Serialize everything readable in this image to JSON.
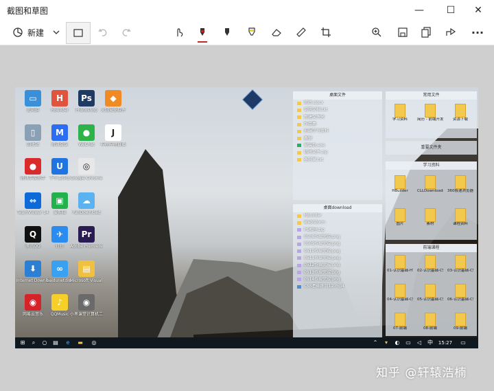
{
  "app": {
    "title": "截图和草图"
  },
  "window_controls": {
    "minimize": "—",
    "maximize": "☐",
    "close": "✕"
  },
  "toolbar": {
    "new_label": "新建",
    "icons": [
      "new-snip-icon",
      "chevron-down-icon",
      "open-file-icon",
      "undo-icon",
      "redo-icon",
      "touch-writing-icon",
      "ballpoint-pen-icon",
      "pencil-icon",
      "highlighter-icon",
      "eraser-icon",
      "ruler-icon",
      "crop-icon",
      "zoom-in-icon",
      "save-icon",
      "copy-icon",
      "share-icon",
      "more-icon"
    ],
    "more_label": "···",
    "accent_color": "#c62828"
  },
  "desktop": {
    "icons": [
      {
        "label": "此电脑",
        "color": "#3a8fd9",
        "glyph": "▭"
      },
      {
        "label": "HBuilder",
        "color": "#e0533c",
        "glyph": "H"
      },
      {
        "label": "Photoshop",
        "color": "#1f3a63",
        "glyph": "Ps"
      },
      {
        "label": "火绒安全软件",
        "color": "#f08a24",
        "glyph": "◆"
      },
      {
        "label": "回收站",
        "color": "#8aa0b4",
        "glyph": "▯"
      },
      {
        "label": "腾讯会议",
        "color": "#2b6ef2",
        "glyph": "M"
      },
      {
        "label": "WeChat",
        "color": "#2db34a",
        "glyph": "●"
      },
      {
        "label": "哔哩哔哩直播",
        "color": "#ffffff",
        "glyph": "J"
      },
      {
        "label": "腾讯手游助手",
        "color": "#d92b2b",
        "glyph": "●"
      },
      {
        "label": "千牛工作台",
        "color": "#1f74e0",
        "glyph": "U"
      },
      {
        "label": "Google Chrome",
        "color": "#e8e8e8",
        "glyph": "◎"
      },
      {
        "label": "",
        "color": "",
        "glyph": ""
      },
      {
        "label": "TeamViewer 14",
        "color": "#0e6ad8",
        "glyph": "⇔"
      },
      {
        "label": "爱剪辑",
        "color": "#22b14c",
        "glyph": "▣"
      },
      {
        "label": "PanDownload",
        "color": "#5ab3f0",
        "glyph": "☁"
      },
      {
        "label": "",
        "color": "",
        "glyph": ""
      },
      {
        "label": "腾讯QQ",
        "color": "#111111",
        "glyph": "Q"
      },
      {
        "label": "钉钉",
        "color": "#2a8cf0",
        "glyph": "✈"
      },
      {
        "label": "Adobe Premiere Pro",
        "color": "#2b1b53",
        "glyph": "Pr"
      },
      {
        "label": "",
        "color": "",
        "glyph": ""
      },
      {
        "label": "Internet Download Manager",
        "color": "#2d7fd3",
        "glyph": "⬇"
      },
      {
        "label": "baidunetdisk",
        "color": "#3aa0f0",
        "glyph": "∞"
      },
      {
        "label": "Microsoft Visual C++ 2...",
        "color": "#f0c040",
        "glyph": "▤"
      },
      {
        "label": "",
        "color": "",
        "glyph": ""
      },
      {
        "label": "网易云音乐",
        "color": "#d6232a",
        "glyph": "◉"
      },
      {
        "label": "QQMusic",
        "color": "#f6cf28",
        "glyph": "♪"
      },
      {
        "label": "小黑课堂计算机二级",
        "color": "#6a6a6a",
        "glyph": "◉"
      }
    ],
    "panel_a": {
      "title": "桌面文件",
      "items": [
        {
          "name": "简历.docx",
          "type": "folder"
        },
        {
          "name": "说明文档.txt",
          "type": "folder"
        },
        {
          "name": "新建文件夹",
          "type": "folder"
        },
        {
          "name": "作品集",
          "type": "folder"
        },
        {
          "name": "前端学习资料",
          "type": "folder"
        },
        {
          "name": "备份",
          "type": "folder"
        },
        {
          "name": "安装包.exe",
          "type": "exe"
        },
        {
          "name": "临时文件.zip",
          "type": "folder"
        },
        {
          "name": "备忘录.txt",
          "type": "folder"
        }
      ]
    },
    "panel_b": {
      "title": "桌面download",
      "items": [
        {
          "name": "HBuilder",
          "type": "folder"
        },
        {
          "name": "WebStorm",
          "type": "folder"
        },
        {
          "name": "PS教程.zip",
          "type": "img"
        },
        {
          "name": "0508作业完成.png",
          "type": "img"
        },
        {
          "name": "0509作业完成.png",
          "type": "img"
        },
        {
          "name": "0510作业完成.png",
          "type": "img"
        },
        {
          "name": "0511作业完成.png",
          "type": "img"
        },
        {
          "name": "0512作业完成.png",
          "type": "img"
        },
        {
          "name": "0513作业完成.png",
          "type": "img"
        },
        {
          "name": "0514作业完成.png",
          "type": "img"
        },
        {
          "name": "CSS基础练习12.mp4",
          "type": "vid"
        }
      ]
    },
    "panel_c": {
      "title": "常用文件",
      "items": [
        "学习资料",
        "简历 - 前端开发",
        "资源下载"
      ]
    },
    "panel_d": {
      "title": "重要文件夹"
    },
    "panel_e": {
      "title": "学习资料",
      "items": [
        "HBuilder",
        "CLLDownloads",
        "360极速浏览器下载",
        "图片",
        "素材",
        "课程资料"
      ]
    },
    "panel_f": {
      "title": "前端课程",
      "items": [
        "01-认识基础-HTML",
        "02-认识基础-CSS一",
        "03-认识基础-CSS一",
        "04-认识基础-CSS二",
        "05-认识基础-CSS三",
        "06-认识基础-CSS实例",
        "07-前端",
        "08-前端",
        "09-前端"
      ]
    },
    "taskbar": {
      "time": "15:27"
    }
  },
  "watermark": {
    "text": "知乎 @轩辕浩楠"
  }
}
